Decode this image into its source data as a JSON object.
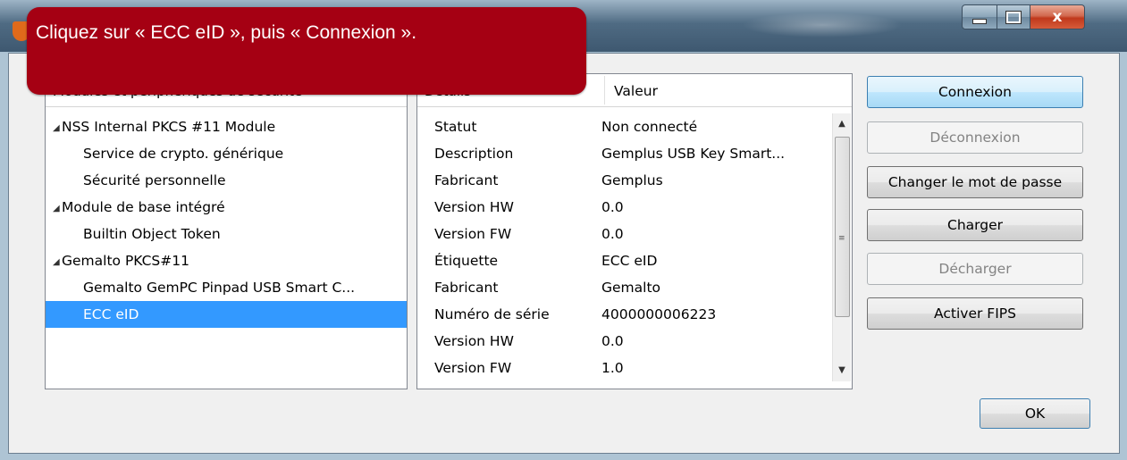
{
  "window": {
    "close_glyph": "x"
  },
  "callout": {
    "text": "Cliquez sur « ECC eID », puis « Connexion »."
  },
  "tree": {
    "header": "Modules et périphériques de sécurité",
    "items": [
      {
        "label": "NSS Internal PKCS #11 Module",
        "level": 0,
        "expanded": true
      },
      {
        "label": "Service de crypto. générique",
        "level": 1
      },
      {
        "label": "Sécurité personnelle",
        "level": 1
      },
      {
        "label": "Module de base intégré",
        "level": 0,
        "expanded": true
      },
      {
        "label": "Builtin Object Token",
        "level": 1
      },
      {
        "label": "Gemalto PKCS#11",
        "level": 0,
        "expanded": true
      },
      {
        "label": "Gemalto GemPC Pinpad USB Smart C...",
        "level": 1
      },
      {
        "label": "ECC eID",
        "level": 1,
        "selected": true
      }
    ]
  },
  "details": {
    "col_details": "Détails",
    "col_value": "Valeur",
    "rows": [
      {
        "key": "Statut",
        "value": "Non connecté"
      },
      {
        "key": "Description",
        "value": "Gemplus USB Key Smart..."
      },
      {
        "key": "Fabricant",
        "value": "Gemplus"
      },
      {
        "key": "Version HW",
        "value": "0.0"
      },
      {
        "key": "Version FW",
        "value": "0.0"
      },
      {
        "key": "Étiquette",
        "value": "ECC eID"
      },
      {
        "key": "Fabricant",
        "value": "Gemalto"
      },
      {
        "key": "Numéro de série",
        "value": "4000000006223"
      },
      {
        "key": "Version HW",
        "value": "0.0"
      },
      {
        "key": "Version FW",
        "value": "1.0"
      }
    ]
  },
  "buttons": {
    "connect": "Connexion",
    "disconnect": "Déconnexion",
    "change_password": "Changer le mot de passe",
    "load": "Charger",
    "unload": "Décharger",
    "enable_fips": "Activer FIPS",
    "ok": "OK"
  },
  "colors": {
    "callout_bg": "#a50013",
    "selection": "#3399ff"
  },
  "icons": {
    "expand": "expanded-triangle-icon",
    "scroll_up": "scroll-up-arrow-icon",
    "scroll_down": "scroll-down-arrow-icon"
  }
}
